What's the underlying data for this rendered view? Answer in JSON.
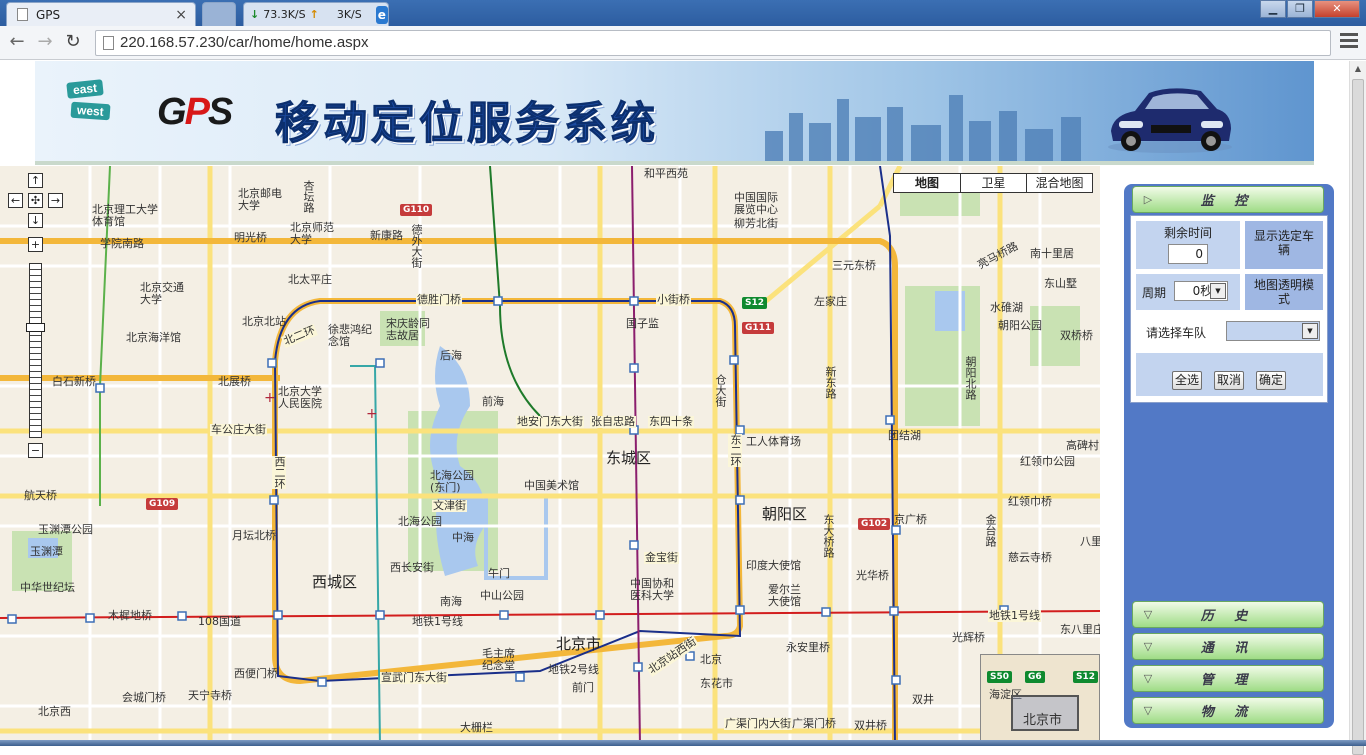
{
  "browser": {
    "tab_title": "GPS",
    "tab_close": "×",
    "net_down": "73.3K/S",
    "net_up": "3K/S",
    "url": "220.168.57.230/car/home/home.aspx"
  },
  "banner": {
    "sign_east": "east",
    "sign_west": "west",
    "logo_text_1": "G",
    "logo_text_2": "P",
    "logo_text_3": "S",
    "title": "移动定位服务系统"
  },
  "map": {
    "types": [
      "地图",
      "卫星",
      "混合地图"
    ],
    "overview_label": "北京市",
    "overview_district": "海淀区",
    "labels": {
      "l1": "和平西苑",
      "l2": "北京邮电大学",
      "l3": "杏坛路",
      "l4": "北京理工大学体育馆",
      "l5": "学院南路",
      "l6": "明光桥",
      "l7": "北京师范大学",
      "l8": "新康路",
      "l9": "德外大街",
      "l10": "北太平庄",
      "l11": "北京交通大学",
      "l12": "德胜门桥",
      "l13": "小街桥",
      "l14": "中国国际展览中心",
      "l15": "柳芳北街",
      "l16": "三元东桥",
      "l17": "左家庄",
      "l18": "南十里居",
      "l19": "亮马桥路",
      "l20": "东山墅",
      "l21": "水碓湖",
      "l22": "朝阳公园",
      "l23": "双桥桥",
      "l24": "北京海洋馆",
      "l25": "北京北站",
      "l26": "徐悲鸿纪念馆",
      "l27": "宋庆龄同志故居",
      "l28": "后海",
      "l29": "国子监",
      "l30": "白石新桥",
      "l31": "北展桥",
      "l32": "北京大学人民医院",
      "l33": "前海",
      "l34": "地安门东大街",
      "l35": "张自忠路",
      "l36": "东四十条",
      "l37": "车公庄大街",
      "l38": "北海公园(东门)",
      "l39": "东城区",
      "l40": "工人体育场",
      "l41": "团结湖",
      "l42": "红领巾公园",
      "l43": "高碑村",
      "l44": "航天桥",
      "l45": "中国美术馆",
      "l46": "文津街",
      "l47": "朝阳区",
      "l48": "京广桥",
      "l49": "红领巾桥",
      "l50": "北海公园",
      "l51": "月坛北桥",
      "l52": "中海",
      "l53": "西长安街",
      "l54": "午门",
      "l55": "金宝街",
      "l56": "印度大使馆",
      "l57": "光华桥",
      "l58": "慈云寺桥",
      "l59": "西城区",
      "l60": "中国协和医科大学",
      "l61": "爱尔兰大使馆",
      "l62": "南海",
      "l63": "中山公园",
      "l64": "木樨地桥",
      "l65": "108国道",
      "l66": "地铁1号线",
      "l67": "北京市",
      "l68": "永安里桥",
      "l69": "光辉桥",
      "l70": "东八里庄",
      "l71": "西便门桥",
      "l72": "宣武门东大街",
      "l73": "毛主席纪念堂",
      "l74": "地铁2号线",
      "l75": "北京站西街",
      "l76": "北京",
      "l77": "东花市",
      "l78": "双井",
      "l79": "会城门桥",
      "l80": "天宁寺桥",
      "l81": "前门",
      "l82": "广渠门内大街",
      "l83": "广渠门桥",
      "l84": "北京西",
      "l85": "大栅栏",
      "l86": "双井桥",
      "l87": "玉渊潭公园",
      "l88": "玉渊潭",
      "l89": "中华世纪坛",
      "l90": "八里",
      "l91": "地铁1号线",
      "l92": "东二环",
      "l93": "西二环",
      "l94": "北二环",
      "l95": "团结湖",
      "l96": "新东路",
      "l97": "仓大街",
      "l98": "东大桥路",
      "l99": "金台路",
      "l100": "朝阳北路"
    }
  },
  "side": {
    "monitor": "监 控",
    "remain_time": "剩余时间",
    "remain_value": "0",
    "show_selected": "显示选定车辆",
    "period_label": "周期",
    "period_value": "0秒",
    "transparent": "地图透明模式",
    "fleet_label": "请选择车队",
    "fleet_value": "",
    "btn_all": "全选",
    "btn_cancel": "取消",
    "btn_ok": "确定",
    "history": "历 史",
    "comm": "通 讯",
    "manage": "管 理",
    "logistics": "物 流"
  }
}
